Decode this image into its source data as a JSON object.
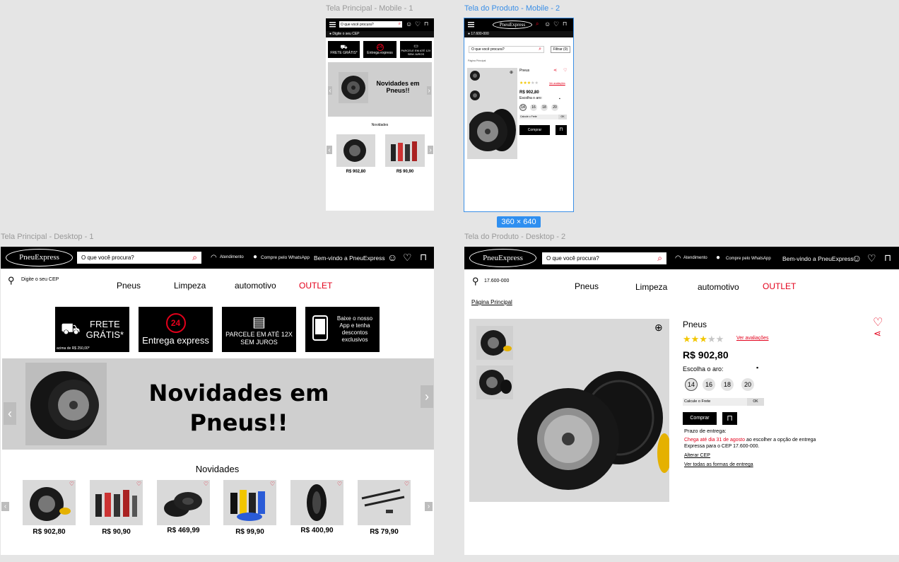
{
  "canvas_labels": {
    "mobile1": "Tela Principal - Mobile - 1",
    "mobile2": "Tela do Produto - Mobile - 2",
    "desktop1": "Tela Principal - Desktop - 1",
    "desktop2": "Tela do Produto - Desktop - 2",
    "selection_size": "360 × 640"
  },
  "brand": {
    "logo_text": "PneuExpress",
    "accent": "#e3001b",
    "selection": "#2f8ff0"
  },
  "header": {
    "search_placeholder": "O que você procura?",
    "atendimento": "Atendimento",
    "whatsapp": "Compre pelo WhatsApp",
    "welcome": "Bem-vindo a PneuExpress"
  },
  "cep": {
    "prompt": "Digite o seu CEP",
    "value": "17.600-000"
  },
  "nav": {
    "pneus": "Pneus",
    "limpeza": "Limpeza",
    "automotivo": "automotivo",
    "outlet": "OUTLET"
  },
  "benefits": {
    "frete_title": "FRETE GRÁTIS*",
    "frete_line1": "FRETE",
    "frete_line2": "GRÁTIS*",
    "frete_note": "acima de R$ 250,00*",
    "entrega": "Entrega express",
    "parcele": "PARCELE EM ATÉ 12X SEM JUROS",
    "parcele_line1": "PARCELE EM ATÉ 12X",
    "parcele_line2": "SEM JUROS",
    "app": "Baixe o nosso App e tenha descontos exclusivos",
    "badge_24": "24"
  },
  "banner": {
    "line1": "Novidades em",
    "line2": "Pneus!!"
  },
  "novidades": {
    "title": "Novidades",
    "products": [
      {
        "name": "pneu",
        "price": "R$ 902,80"
      },
      {
        "name": "limpeza-kit",
        "price": "R$ 90,90"
      },
      {
        "name": "pneus-empilhados",
        "price": "R$ 469,99"
      },
      {
        "name": "kit-lavagem",
        "price": "R$ 99,90"
      },
      {
        "name": "pneu-lateral",
        "price": "R$ 400,90"
      },
      {
        "name": "palhetas",
        "price": "R$ 79,90"
      }
    ]
  },
  "product": {
    "breadcrumb": "Página Principal",
    "title": "Pneus",
    "reviews_link": "Ver avaliações",
    "rating": 3,
    "rating_max": 5,
    "price": "R$ 902,80",
    "aro_label": "Escolha o aro:",
    "aros": [
      "14",
      "16",
      "18",
      "20"
    ],
    "frete_placeholder": "Calcule o Frete",
    "ok": "OK",
    "buy": "Comprar",
    "prazo_title": "Prazo de entrega:",
    "prazo_highlight": "Chega até dia 31 de agosto",
    "prazo_rest": " ao escolher a opção de entrega Expressa para o CEP 17.600-000.",
    "alterar_cep": "Alterar CEP",
    "ver_formas": "Ver todas as formas de entrega"
  },
  "mobile": {
    "filter": "Filtrar (0)"
  }
}
